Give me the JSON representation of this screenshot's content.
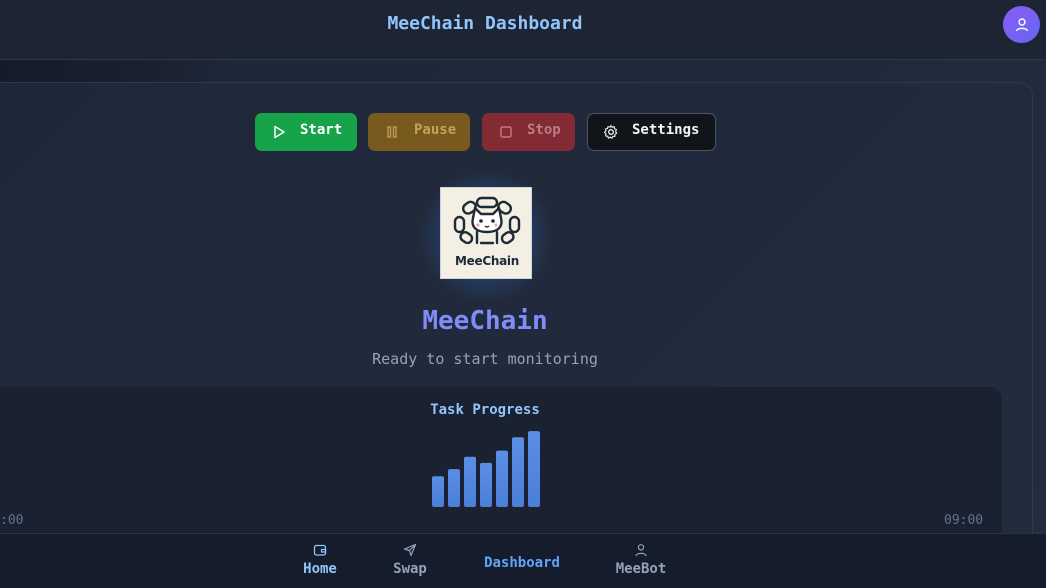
{
  "header": {
    "title": "MeeChain Dashboard",
    "avatar_icon": "user-icon"
  },
  "controls": {
    "start_label": "Start",
    "pause_label": "Pause",
    "stop_label": "Stop",
    "settings_label": "Settings"
  },
  "brand": {
    "logo_text": "MeeChain",
    "name": "MeeChain",
    "status": "Ready to start monitoring"
  },
  "progress": {
    "title": "Task Progress",
    "time_start": ":00",
    "time_end": "09:00"
  },
  "chart_data": {
    "type": "bar",
    "title": "Task Progress",
    "categories": [],
    "values": [
      30,
      37,
      49,
      43,
      55,
      68,
      74
    ],
    "ylim": [
      0,
      80
    ],
    "color": "#4a7fd8"
  },
  "nav": {
    "home": "Home",
    "swap": "Swap",
    "dashboard": "Dashboard",
    "meebot": "MeeBot"
  },
  "colors": {
    "accent": "#818cf8",
    "start": "#16a34a",
    "pause": "#785a1e",
    "stop": "#822b34",
    "link": "#93c5fd"
  }
}
